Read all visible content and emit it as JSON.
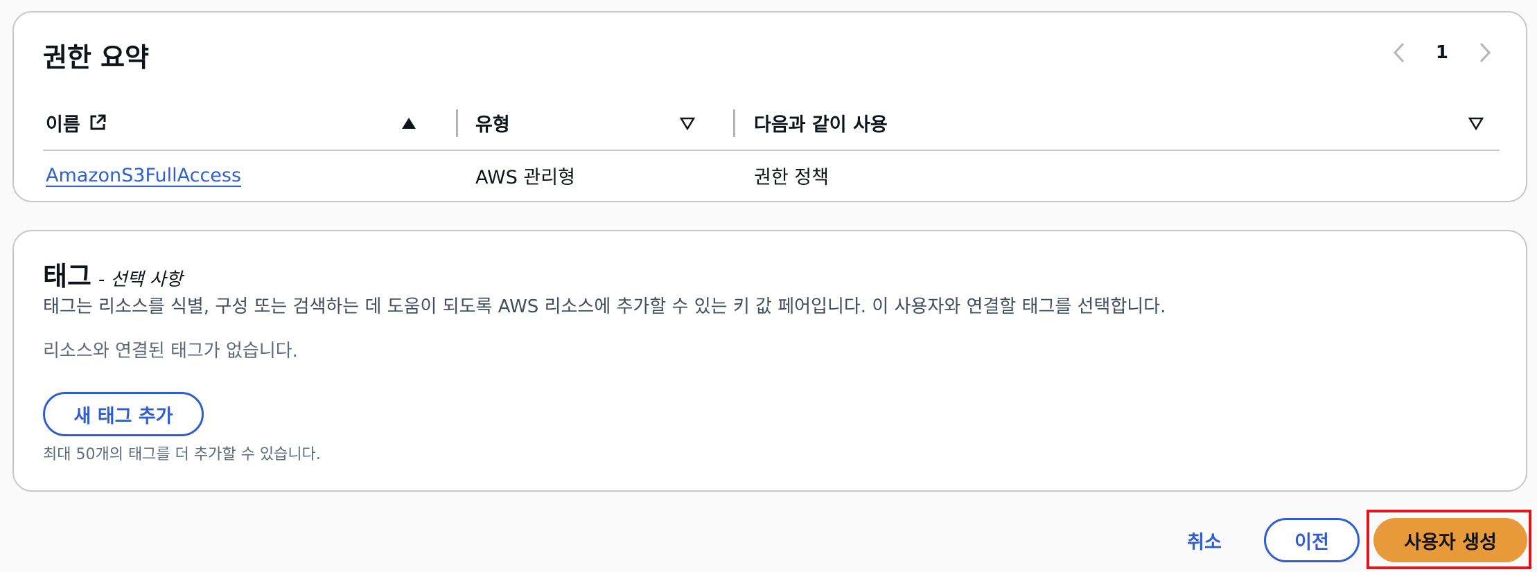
{
  "permissions": {
    "title": "권한 요약",
    "pager": {
      "current_page": "1"
    },
    "columns": [
      {
        "label": "이름",
        "sort": "ascending"
      },
      {
        "label": "유형",
        "sort": "none"
      },
      {
        "label": "다음과 같이 사용",
        "sort": "none"
      }
    ],
    "rows": [
      {
        "name": "AmazonS3FullAccess",
        "type": "AWS 관리형",
        "used_as": "권한 정책"
      }
    ]
  },
  "tags": {
    "title": "태그",
    "subtitle": "- 선택 사항",
    "description": "태그는 리소스를 식별, 구성 또는 검색하는 데 도움이 되도록 AWS 리소스에 추가할 수 있는 키 값 페어입니다. 이 사용자와 연결할 태그를 선택합니다.",
    "empty_text": "리소스와 연결된 태그가 없습니다.",
    "add_button": "새 태그 추가",
    "limit_text": "최대 50개의 태그를 더 추가할 수 있습니다."
  },
  "footer": {
    "cancel_label": "취소",
    "previous_label": "이전",
    "create_label": "사용자 생성"
  },
  "colors": {
    "primary": "#2e5cd3",
    "create_button": "#e8993a",
    "highlight": "#e0161c"
  }
}
